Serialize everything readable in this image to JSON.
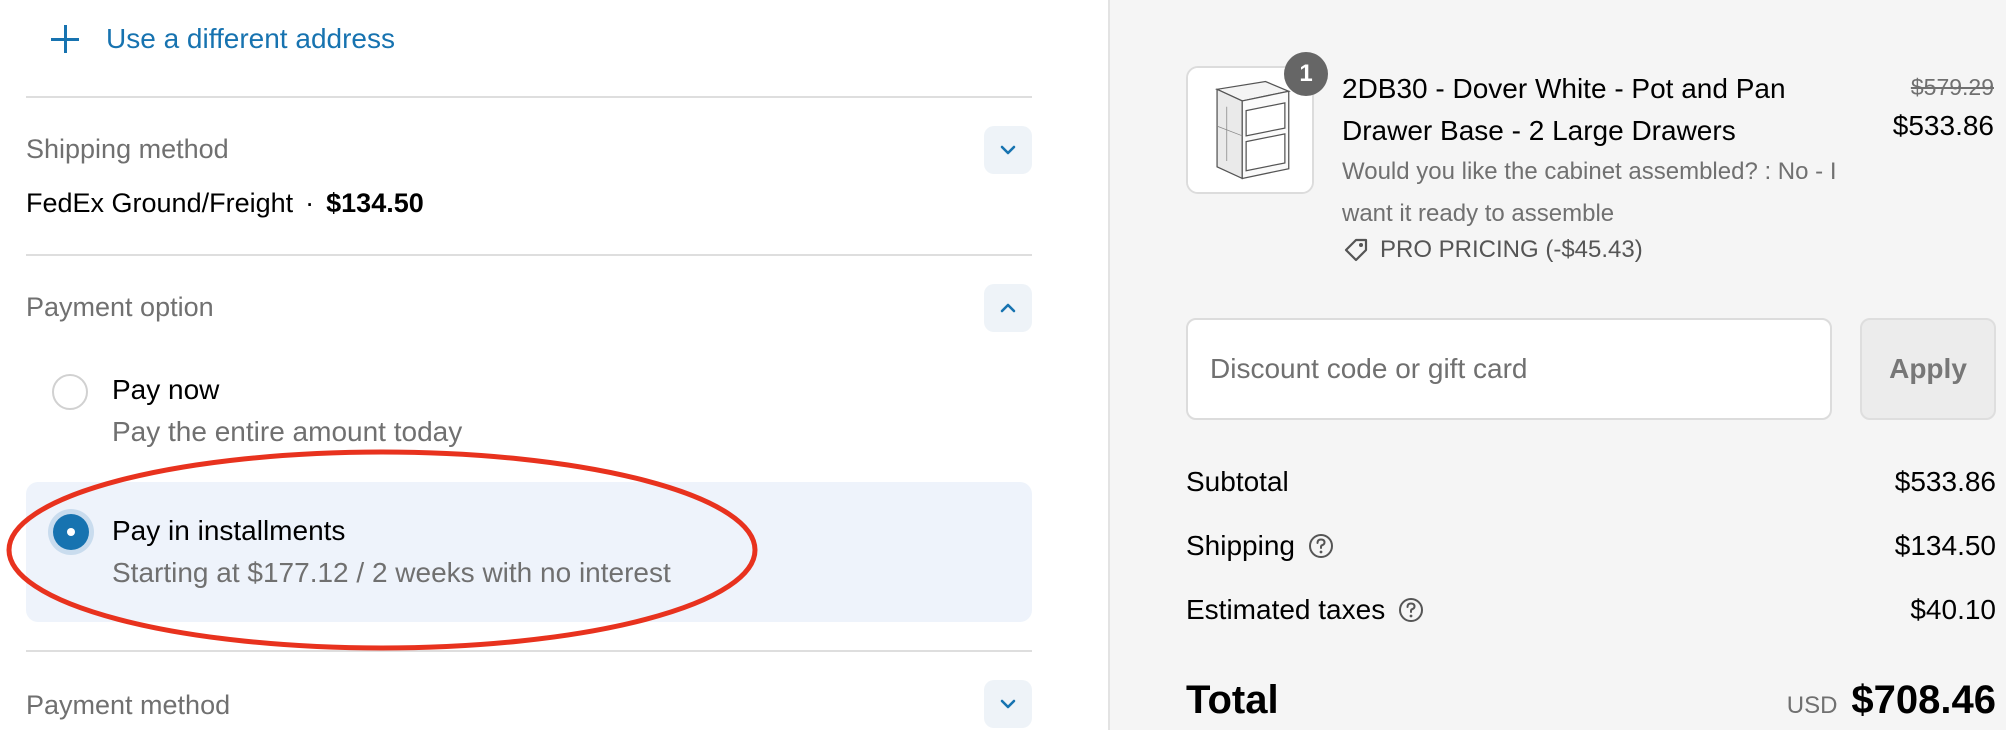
{
  "address": {
    "use_different_label": "Use a different address"
  },
  "shipping": {
    "title": "Shipping method",
    "carrier": "FedEx Ground/Freight",
    "separator": "·",
    "price": "$134.50"
  },
  "payment_option": {
    "title": "Payment option",
    "options": [
      {
        "title": "Pay now",
        "subtitle": "Pay the entire amount today",
        "selected": false
      },
      {
        "title": "Pay in installments",
        "subtitle": "Starting at $177.12 / 2 weeks with no interest",
        "selected": true
      }
    ]
  },
  "payment_method": {
    "title": "Payment method"
  },
  "cart": {
    "item": {
      "quantity": "1",
      "title": "2DB30 - Dover White - Pot and Pan Drawer Base - 2 Large Drawers",
      "option": "Would you like the cabinet assembled? : No - I want it ready to assemble",
      "promo": "PRO PRICING (-$45.43)",
      "original_price": "$579.29",
      "price": "$533.86"
    },
    "discount": {
      "placeholder": "Discount code or gift card",
      "apply_label": "Apply"
    },
    "summary": {
      "subtotal_label": "Subtotal",
      "subtotal": "$533.86",
      "shipping_label": "Shipping",
      "shipping": "$134.50",
      "taxes_label": "Estimated taxes",
      "taxes": "$40.10",
      "total_label": "Total",
      "currency": "USD",
      "total": "$708.46"
    }
  },
  "colors": {
    "accent": "#1773b0",
    "annotation": "#e8321e",
    "selected_bg": "#eef3fb",
    "sidebar_bg": "#f5f5f5"
  }
}
